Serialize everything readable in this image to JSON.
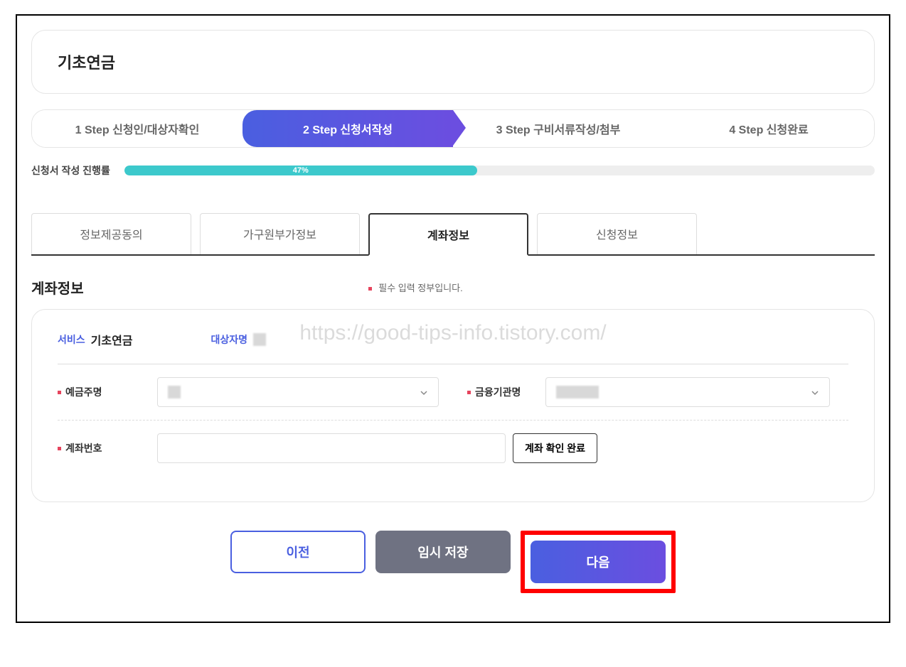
{
  "page_title": "기초연금",
  "steps": [
    {
      "label": "1 Step 신청인/대상자확인",
      "active": false
    },
    {
      "label": "2 Step 신청서작성",
      "active": true
    },
    {
      "label": "3 Step 구비서류작성/첨부",
      "active": false
    },
    {
      "label": "4 Step 신청완료",
      "active": false
    }
  ],
  "progress": {
    "label": "신청서 작성 진행률",
    "percent_text": "47%",
    "percent_value": 47
  },
  "tabs": [
    {
      "label": "정보제공동의",
      "active": false
    },
    {
      "label": "가구원부가정보",
      "active": false
    },
    {
      "label": "계좌정보",
      "active": true
    },
    {
      "label": "신청정보",
      "active": false
    }
  ],
  "section": {
    "title": "계좌정보",
    "required_note": "필수 입력 정부입니다."
  },
  "watermark": "https://good-tips-info.tistory.com/",
  "form": {
    "service_label": "서비스",
    "service_value": "기초연금",
    "target_label": "대상자명",
    "fields": {
      "holder_label": "예금주명",
      "bank_label": "금융기관명",
      "account_label": "계좌번호",
      "verify_button": "계좌 확인 완료"
    }
  },
  "buttons": {
    "prev": "이전",
    "save": "임시 저장",
    "next": "다음"
  }
}
